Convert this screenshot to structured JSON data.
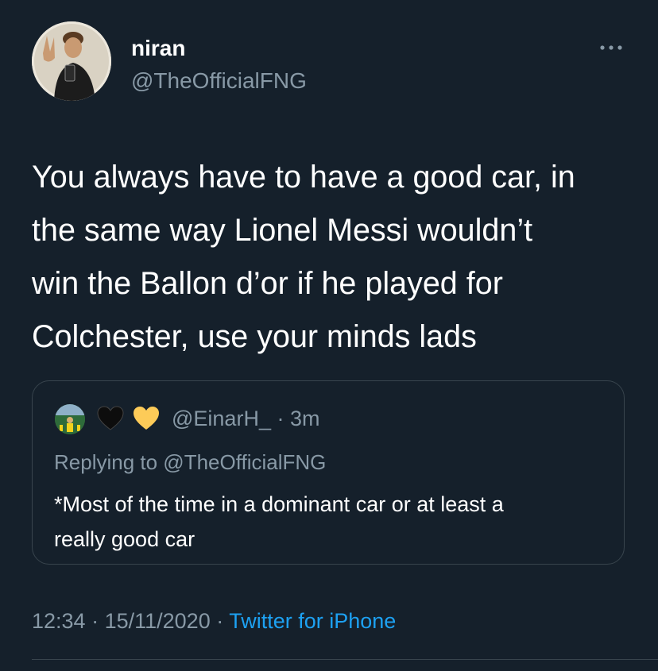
{
  "author": {
    "display_name": "niran",
    "handle": "@TheOfficialFNG"
  },
  "tweet": {
    "text_lines": [
      "You always have to have a good car, in",
      "the same way Lionel Messi wouldn’t",
      "win the Ballon d’or if he played for",
      "Colchester, use your minds lads"
    ]
  },
  "quote": {
    "handle_and_time": "@EinarH_ · 3m",
    "icons": [
      "black-heart-icon",
      "yellow-heart-icon"
    ],
    "replying_to": "Replying to @TheOfficialFNG",
    "text_lines": [
      "*Most of the time in a dominant car or at least a",
      "really good car"
    ]
  },
  "meta": {
    "time": "12:34",
    "separator1": " · ",
    "date": "15/11/2020",
    "separator2": " · ",
    "source": "Twitter for iPhone"
  },
  "colors": {
    "background": "#15202b",
    "secondary_text": "#8899a6",
    "link": "#1da1f2",
    "border": "#38444d"
  }
}
